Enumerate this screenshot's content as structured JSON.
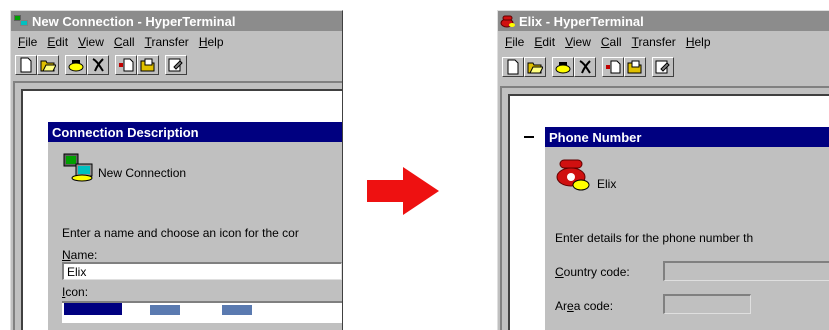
{
  "left_window": {
    "title": "New Connection - HyperTerminal",
    "menu": [
      "File",
      "Edit",
      "View",
      "Call",
      "Transfer",
      "Help"
    ],
    "dialog": {
      "title": "Connection Description",
      "connection_name": "New Connection",
      "instruction": "Enter a name and choose an icon for the cor",
      "name_label": "Name:",
      "name_value": "Elix",
      "icon_label": "Icon:"
    }
  },
  "right_window": {
    "title": "Elix - HyperTerminal",
    "menu": [
      "File",
      "Edit",
      "View",
      "Call",
      "Transfer",
      "Help"
    ],
    "dialog": {
      "title": "Phone Number",
      "connection_name": "Elix",
      "instruction": "Enter details for the phone number th",
      "country_label": "Country code:",
      "area_label": "Area code:"
    }
  },
  "colors": {
    "arrow": "#ee1111",
    "dialog_title": "#000080",
    "inactive_title": "#8c8c8c"
  },
  "icons": [
    "hyperterminal-icon",
    "phone-icon",
    "new-icon",
    "open-icon",
    "connect-icon",
    "disconnect-icon",
    "send-icon",
    "receive-icon",
    "properties-icon"
  ]
}
